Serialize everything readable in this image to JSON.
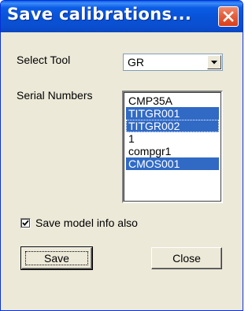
{
  "window": {
    "title": "Save calibrations...",
    "close_icon": "close-icon"
  },
  "form": {
    "select_tool_label": "Select Tool",
    "select_tool_value": "GR",
    "serial_numbers_label": "Serial Numbers",
    "serial_numbers": [
      {
        "label": "CMP35A",
        "selected": false
      },
      {
        "label": "TITGR001",
        "selected": true
      },
      {
        "label": "TITGR002",
        "selected": true
      },
      {
        "label": "1",
        "selected": false
      },
      {
        "label": "compgr1",
        "selected": false
      },
      {
        "label": "CMOS001",
        "selected": true
      }
    ],
    "save_model_label": "Save model info also",
    "save_model_checked": true
  },
  "buttons": {
    "save_label": "Save",
    "close_label": "Close"
  },
  "colors": {
    "title_bar": "#0a52d8",
    "selection": "#316ac5",
    "close_button": "#e5603d",
    "dialog_background": "#ece9d8"
  }
}
